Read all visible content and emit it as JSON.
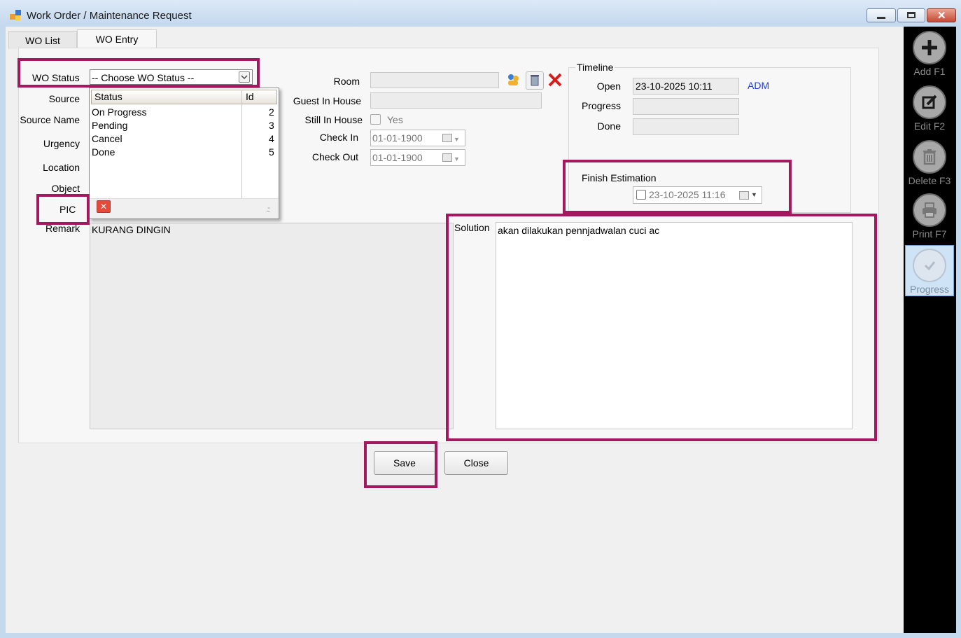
{
  "window": {
    "title": "Work Order / Maintenance Request"
  },
  "tabs": [
    {
      "label": "WO List"
    },
    {
      "label": "WO Entry"
    }
  ],
  "form": {
    "wo_status_label": "WO Status",
    "wo_status_value": "-- Choose WO Status --",
    "source_label": "Source",
    "source_name_label": "Source Name",
    "urgency_label": "Urgency",
    "location_label": "Location",
    "object_label": "Object",
    "pic_label": "PIC",
    "remark_label": "Remark",
    "remark_value": "KURANG DINGIN",
    "room_label": "Room",
    "guest_in_house_label": "Guest In House",
    "still_in_house_label": "Still In House",
    "still_in_house_option": "Yes",
    "check_in_label": "Check In",
    "check_in_value": "01-01-1900",
    "check_out_label": "Check Out",
    "check_out_value": "01-01-1900",
    "solution_label": "Solution",
    "solution_value": "akan dilakukan pennjadwalan cuci ac"
  },
  "status_dropdown": {
    "headers": {
      "status": "Status",
      "id": "Id"
    },
    "rows": [
      {
        "status": "On Progress",
        "id": "2"
      },
      {
        "status": "Pending",
        "id": "3"
      },
      {
        "status": "Cancel",
        "id": "4"
      },
      {
        "status": "Done",
        "id": "5"
      }
    ]
  },
  "timeline": {
    "title": "Timeline",
    "open_label": "Open",
    "open_value": "23-10-2025 10:11",
    "open_user": "ADM",
    "progress_label": "Progress",
    "done_label": "Done",
    "finish_estimation_label": "Finish Estimation",
    "finish_estimation_value": "23-10-2025 11:16"
  },
  "buttons": {
    "save": "Save",
    "close": "Close"
  },
  "sidebar": [
    {
      "label": "Add F1",
      "icon": "plus-icon"
    },
    {
      "label": "Edit F2",
      "icon": "edit-icon"
    },
    {
      "label": "Delete F3",
      "icon": "trash-icon"
    },
    {
      "label": "Print F7",
      "icon": "printer-icon"
    },
    {
      "label": "Progress",
      "icon": "progress-check-icon"
    }
  ],
  "colors": {
    "highlight": "#a3185f",
    "link": "#1a3cff",
    "sidebar_bg": "#000000"
  }
}
